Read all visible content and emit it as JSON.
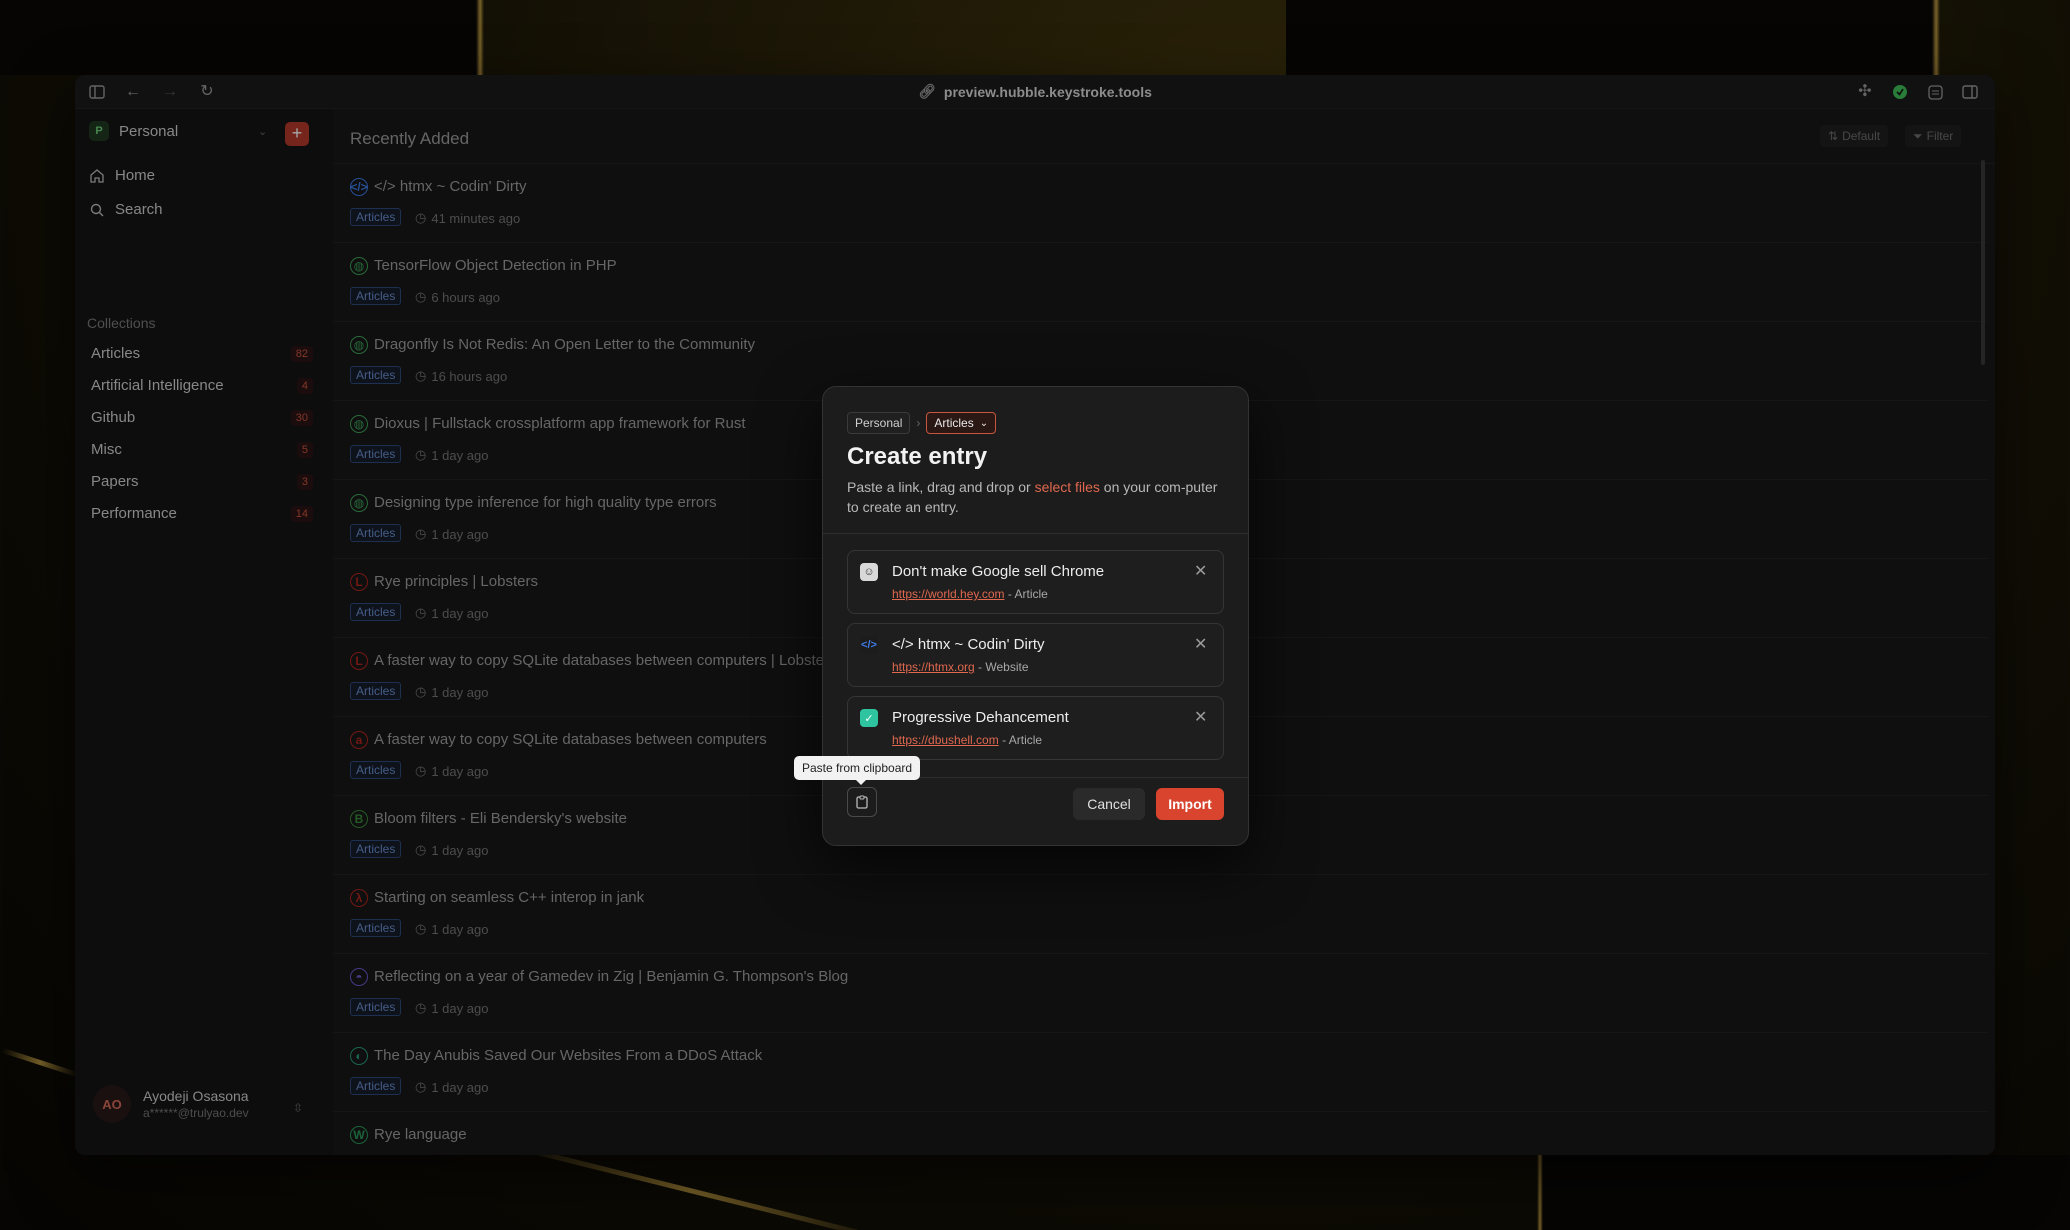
{
  "browser": {
    "url": "preview.hubble.keystroke.tools"
  },
  "sidebar": {
    "workspace_initial": "P",
    "workspace_name": "Personal",
    "add_label": "+",
    "nav": [
      {
        "label": "Home",
        "icon": "home-icon"
      },
      {
        "label": "Search",
        "icon": "search-icon"
      }
    ],
    "collections_heading": "Collections",
    "collections": [
      {
        "label": "Articles",
        "count": "82"
      },
      {
        "label": "Artificial Intelligence",
        "count": "4"
      },
      {
        "label": "Github",
        "count": "30"
      },
      {
        "label": "Misc",
        "count": "5"
      },
      {
        "label": "Papers",
        "count": "3"
      },
      {
        "label": "Performance",
        "count": "14"
      }
    ],
    "user": {
      "initials": "AO",
      "name": "Ayodeji Osasona",
      "email": "a******@trulyao.dev"
    }
  },
  "main": {
    "title": "Recently Added",
    "sort_label": "Default",
    "filter_label": "Filter",
    "rows": [
      {
        "title": "</> htmx ~ Codin' Dirty",
        "tag": "Articles",
        "time": "41 minutes ago",
        "icon": "code-icon",
        "icon_text": "</>",
        "icon_color": "#3d7be8"
      },
      {
        "title": "TensorFlow Object Detection in PHP",
        "tag": "Articles",
        "time": "6 hours ago",
        "icon": "globe-icon",
        "icon_text": "◍",
        "icon_color": "#3fa35a"
      },
      {
        "title": "Dragonfly Is Not Redis: An Open Letter to the Community",
        "tag": "Articles",
        "time": "16 hours ago",
        "icon": "globe-icon",
        "icon_text": "◍",
        "icon_color": "#3fa35a"
      },
      {
        "title": "Dioxus | Fullstack crossplatform app framework for Rust",
        "tag": "Articles",
        "time": "1 day ago",
        "icon": "globe-icon",
        "icon_text": "◍",
        "icon_color": "#3fa35a"
      },
      {
        "title": "Designing type inference for high quality type errors",
        "tag": "Articles",
        "time": "1 day ago",
        "icon": "globe-icon",
        "icon_text": "◍",
        "icon_color": "#3fa35a"
      },
      {
        "title": "Rye principles | Lobsters",
        "tag": "Articles",
        "time": "1 day ago",
        "icon": "lobsters-icon",
        "icon_text": "L",
        "icon_color": "#b3261e"
      },
      {
        "title": "A faster way to copy SQLite databases between computers | Lobste",
        "tag": "Articles",
        "time": "1 day ago",
        "icon": "lobsters-icon",
        "icon_text": "L",
        "icon_color": "#b3261e"
      },
      {
        "title": "A faster way to copy SQLite databases between computers",
        "tag": "Articles",
        "time": "1 day ago",
        "icon": "site-icon",
        "icon_text": "a",
        "icon_color": "#b3261e"
      },
      {
        "title": "Bloom filters - Eli Bendersky's website",
        "tag": "Articles",
        "time": "1 day ago",
        "icon": "site-icon",
        "icon_text": "B",
        "icon_color": "#3a8a3a"
      },
      {
        "title": "Starting on seamless C++ interop in jank",
        "tag": "Articles",
        "time": "1 day ago",
        "icon": "jank-icon",
        "icon_text": "λ",
        "icon_color": "#b3261e"
      },
      {
        "title": "Reflecting on a year of Gamedev in Zig | Benjamin G. Thompson's Blog",
        "tag": "Articles",
        "time": "1 day ago",
        "icon": "blog-icon",
        "icon_text": "◓",
        "icon_color": "#6a5acd"
      },
      {
        "title": "The Day Anubis Saved Our Websites From a DDoS Attack",
        "tag": "Articles",
        "time": "1 day ago",
        "icon": "anubis-icon",
        "icon_text": "◐",
        "icon_color": "#2a9a7a"
      },
      {
        "title": "Rye language",
        "tag": "",
        "time": "",
        "icon": "rye-icon",
        "icon_text": "W",
        "icon_color": "#2a9a5a"
      }
    ]
  },
  "modal": {
    "crumb_workspace": "Personal",
    "crumb_collection": "Articles",
    "title": "Create entry",
    "desc_before": "Paste a link, drag and drop or ",
    "desc_link": "select files",
    "desc_after": " on your com-puter to create an entry.",
    "entries": [
      {
        "title": "Don't make Google sell Chrome",
        "url": "https://world.hey.com",
        "kind": " - Article",
        "icon": "hey-icon",
        "icon_text": "☺",
        "icon_bg": "#d9d9d9",
        "icon_fg": "#333"
      },
      {
        "title": "</> htmx ~ Codin' Dirty",
        "url": "https://htmx.org",
        "kind": " - Website",
        "icon": "code-icon",
        "icon_text": "</>",
        "icon_bg": "#1c1c1c",
        "icon_fg": "#3d7be8"
      },
      {
        "title": "Progressive Dehancement",
        "url": "https://dbushell.com",
        "kind": " - Article",
        "icon": "dbushell-icon",
        "icon_text": "✓",
        "icon_bg": "#2ec4a0",
        "icon_fg": "#fff"
      }
    ],
    "cancel_label": "Cancel",
    "import_label": "Import",
    "tooltip": "Paste from clipboard"
  }
}
